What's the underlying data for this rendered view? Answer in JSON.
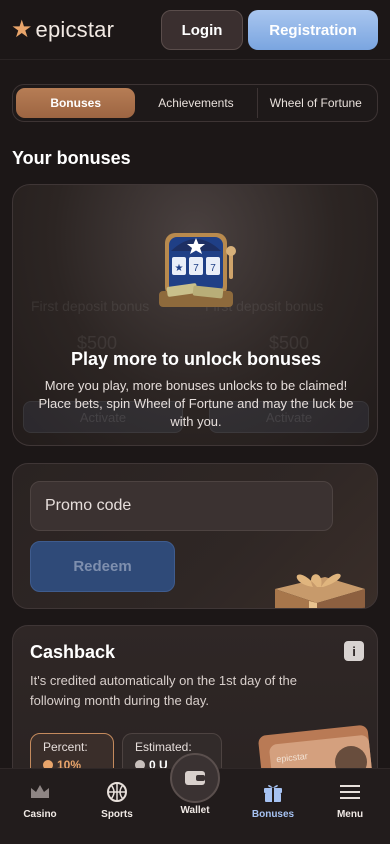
{
  "header": {
    "logo_text": "epicstar",
    "login_label": "Login",
    "registration_label": "Registration"
  },
  "tabs": [
    {
      "label": "Bonuses",
      "active": true
    },
    {
      "label": "Achievements",
      "active": false
    },
    {
      "label": "Wheel of Fortune",
      "active": false
    }
  ],
  "section_title": "Your bonuses",
  "bonus_card": {
    "ghost_left_title": "First deposit bonus",
    "ghost_right_title": "First deposit bonus",
    "ghost_left_amount": "$500",
    "ghost_right_amount": "$500",
    "ghost_activate": "Activate",
    "headline": "Play more to unlock bonuses",
    "description": "More you play, more bonuses unlocks to be claimed! Place bets, spin Wheel of Fortune and may the luck be with you."
  },
  "promo": {
    "placeholder": "Promo code",
    "redeem_label": "Redeem"
  },
  "cashback": {
    "title": "Cashback",
    "description": "It's credited automatically on the 1st day of the following month during the day.",
    "percent_label": "Percent:",
    "percent_value": "10%",
    "estimated_label": "Estimated:",
    "estimated_value": "0 U",
    "card_brand": "epicstar"
  },
  "nav": {
    "casino": "Casino",
    "sports": "Sports",
    "wallet": "Wallet",
    "bonuses": "Bonuses",
    "menu": "Menu"
  },
  "colors": {
    "accent": "#e9a56b",
    "primary_button": "#7aa5e0",
    "redeem_button": "#2f4a78",
    "background": "#1c1717",
    "active_nav": "#a6c2f2"
  }
}
